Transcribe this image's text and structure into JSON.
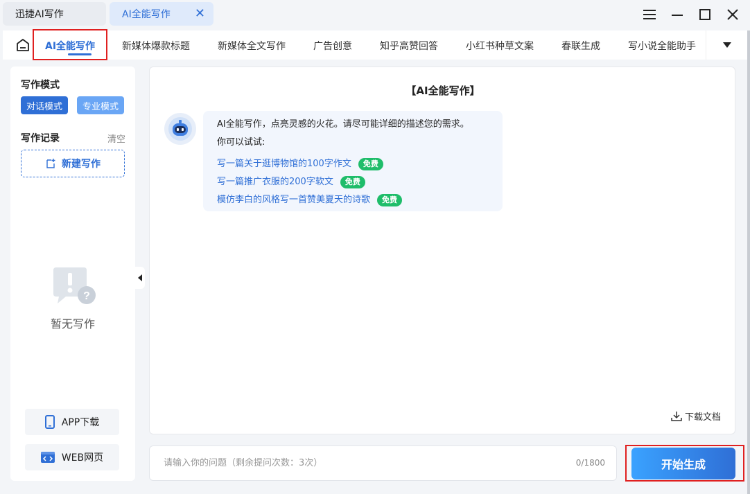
{
  "window": {
    "tabs": [
      {
        "label": "迅捷AI写作"
      },
      {
        "label": "AI全能写作",
        "close": "✕"
      }
    ],
    "controls": {
      "menu": "menu-icon",
      "minimize": "minimize-icon",
      "maximize": "maximize-icon",
      "close": "close-icon"
    }
  },
  "nav": {
    "items": [
      {
        "label": "AI全能写作",
        "active": true
      },
      {
        "label": "新媒体爆款标题"
      },
      {
        "label": "新媒体全文写作"
      },
      {
        "label": "广告创意"
      },
      {
        "label": "知乎高赞回答"
      },
      {
        "label": "小红书种草文案"
      },
      {
        "label": "春联生成"
      },
      {
        "label": "写小说全能助手"
      }
    ]
  },
  "sidebar": {
    "mode_title": "写作模式",
    "mode_dialog": "对话模式",
    "mode_pro": "专业模式",
    "records_title": "写作记录",
    "clear": "清空",
    "new_write": "新建写作",
    "empty": "暂无写作",
    "app_download": "APP下载",
    "web_page": "WEB网页"
  },
  "main": {
    "title": "【AI全能写作】",
    "intro": "AI全能写作，点亮灵感的火花。请尽可能详细的描述您的需求。",
    "try_label": "你可以试试:",
    "suggestions": [
      {
        "text": "写一篇关于逛博物馆的100字作文",
        "badge": "免费"
      },
      {
        "text": "写一篇推广衣服的200字软文",
        "badge": "免费"
      },
      {
        "text": "模仿李白的风格写一首赞美夏天的诗歌",
        "badge": "免费"
      }
    ],
    "download": "下载文档"
  },
  "input": {
    "placeholder": "请输入你的问题（剩余提问次数：3次）",
    "value": "",
    "counter": "0/1800"
  },
  "generate_button": "开始生成",
  "colors": {
    "accent": "#2f6fd6",
    "badge": "#1fbd6a",
    "highlight": "#e02020"
  }
}
